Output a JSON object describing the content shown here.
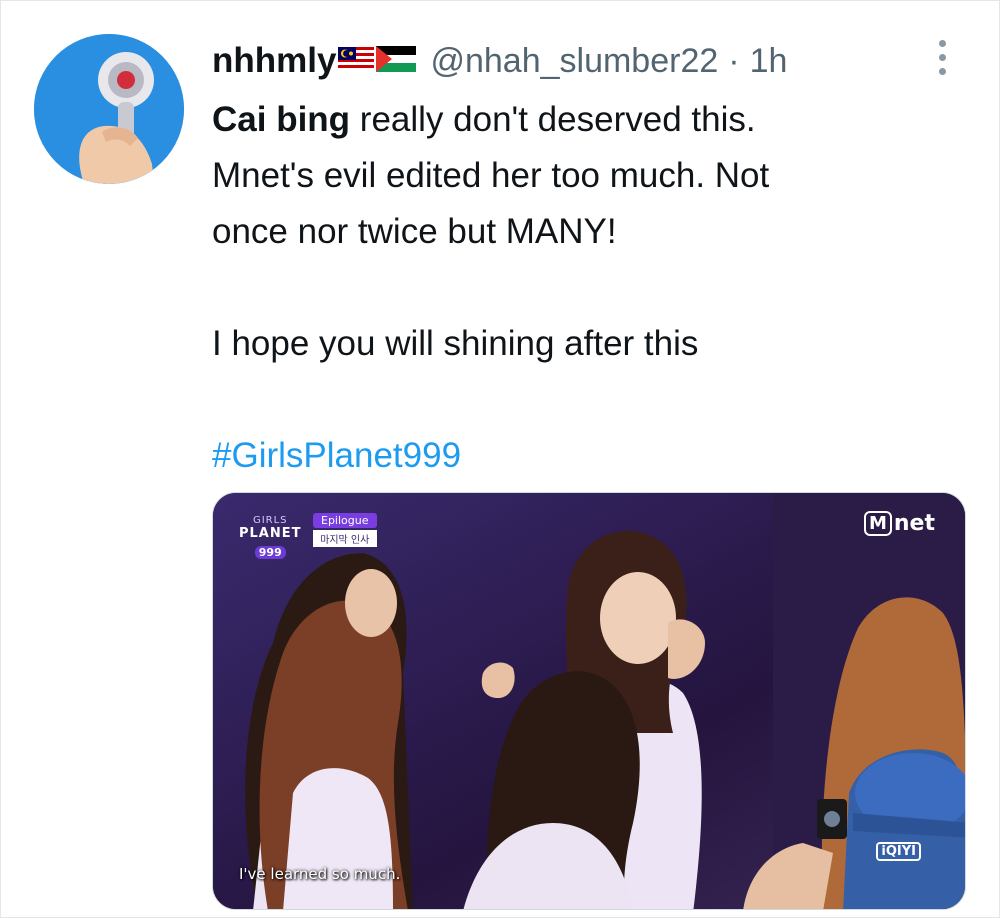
{
  "tweet": {
    "display_name": "nhhmly",
    "flags": [
      "flag-malaysia-icon",
      "flag-palestine-icon"
    ],
    "handle": "@nhah_slumber22",
    "separator": "·",
    "time": "1h",
    "text_bold": "Cai bing",
    "text_line1_rest": " really don't deserved this.",
    "text_line2": "Mnet's evil edited her too much. Not",
    "text_line3": "once nor twice but MANY!",
    "text_paragraph2": "I hope you will shining after this",
    "hashtag": "#GirlsPlanet999",
    "more_icon": "more-vertical-icon"
  },
  "media": {
    "show_badge_line1": "GIRLS",
    "show_badge_line2": "PLANET",
    "show_badge_line3": "999",
    "segment_title": "Epilogue",
    "segment_subtitle": "마지막 인사",
    "broadcaster": "net",
    "broadcaster_mark": "M",
    "streaming_logo": "iQIYI",
    "subtitle": "I've learned so much."
  },
  "colors": {
    "accent": "#1d9bf0",
    "text": "#0f1419",
    "secondary": "#536471"
  }
}
